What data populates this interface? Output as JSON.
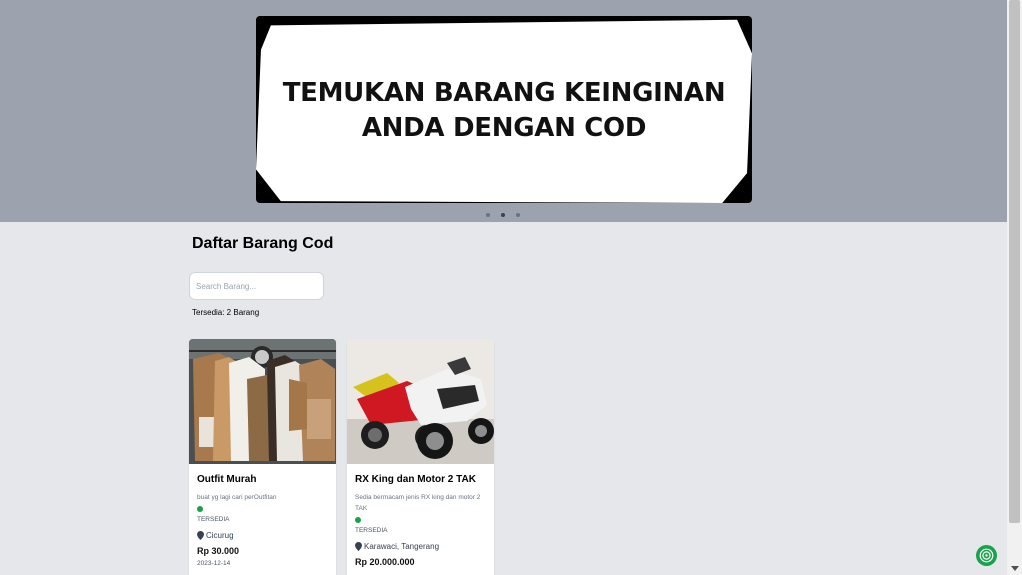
{
  "banner": {
    "text_line1": "TEMUKAN BARANG KEINGINAN",
    "text_line2": "ANDA DENGAN COD",
    "slides": 3,
    "active_slide": 2
  },
  "page_title": "Daftar Barang Cod",
  "search": {
    "placeholder": "Search Barang...",
    "value": ""
  },
  "available_count": "Tersedia: 2 Barang",
  "colors": {
    "status_available": "#16a34a",
    "hero_bg": "#9ca3af",
    "page_bg": "#e5e7eb"
  },
  "items": [
    {
      "title": "Outfit Murah",
      "description": "buat yg lagi cari perOutfitan",
      "status": "TERSEDIA",
      "location": "Cicurug",
      "price": "Rp 30.000",
      "date": "2023-12-14",
      "image_icon": "clothing-rack-photo"
    },
    {
      "title": "RX King dan Motor 2 TAK",
      "description": "Sedia bermacam jenis RX king dan motor 2 TAK",
      "status": "TERSEDIA",
      "location": "Karawaci, Tangerang",
      "price": "Rp 20.000.000",
      "image_icon": "motorcycles-photo"
    }
  ],
  "icons": {
    "location": "map-pin-icon",
    "chat": "chat-support-icon"
  }
}
